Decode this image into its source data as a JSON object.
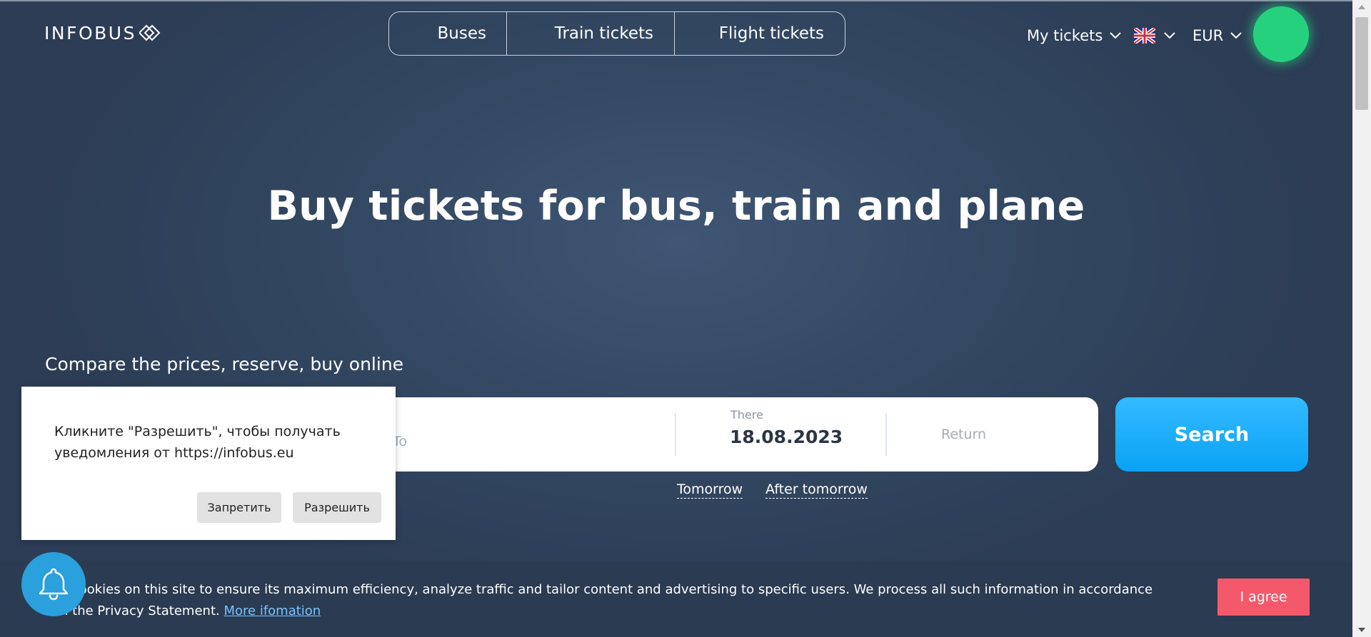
{
  "header": {
    "logo_text": "INFOBUS",
    "tabs": [
      {
        "label": "Buses"
      },
      {
        "label": "Train tickets"
      },
      {
        "label": "Flight tickets"
      }
    ],
    "my_tickets": "My tickets",
    "language_flag": "uk-flag-icon",
    "currency": "EUR"
  },
  "hero": {
    "title": "Buy tickets for bus, train and plane",
    "subtitle": "Compare the prices, reserve, buy online"
  },
  "search": {
    "to_placeholder": "To",
    "there_label": "There",
    "there_date": "18.08.2023",
    "return_placeholder": "Return",
    "button_label": "Search",
    "quick_dates": [
      "Tomorrow",
      "After tomorrow"
    ]
  },
  "notification_popup": {
    "text": "Кликните \"Разрешить\", чтобы получать уведомления от https://infobus.eu",
    "deny_label": "Запретить",
    "allow_label": "Разрешить"
  },
  "cookie_banner": {
    "text_line1": "e cookies on this site to ensure its maximum efficiency, analyze traffic and tailor content and advertising to specific users. We process all such information in accordance",
    "text_line2": "h the Privacy Statement.",
    "link_text": "More ifomation",
    "agree_label": "I agree"
  },
  "colors": {
    "background": "#344963",
    "search_button": "#12a8f8",
    "agree_button": "#f4596b",
    "avatar": "#26d17e",
    "bell_button": "#2aa0dc"
  }
}
